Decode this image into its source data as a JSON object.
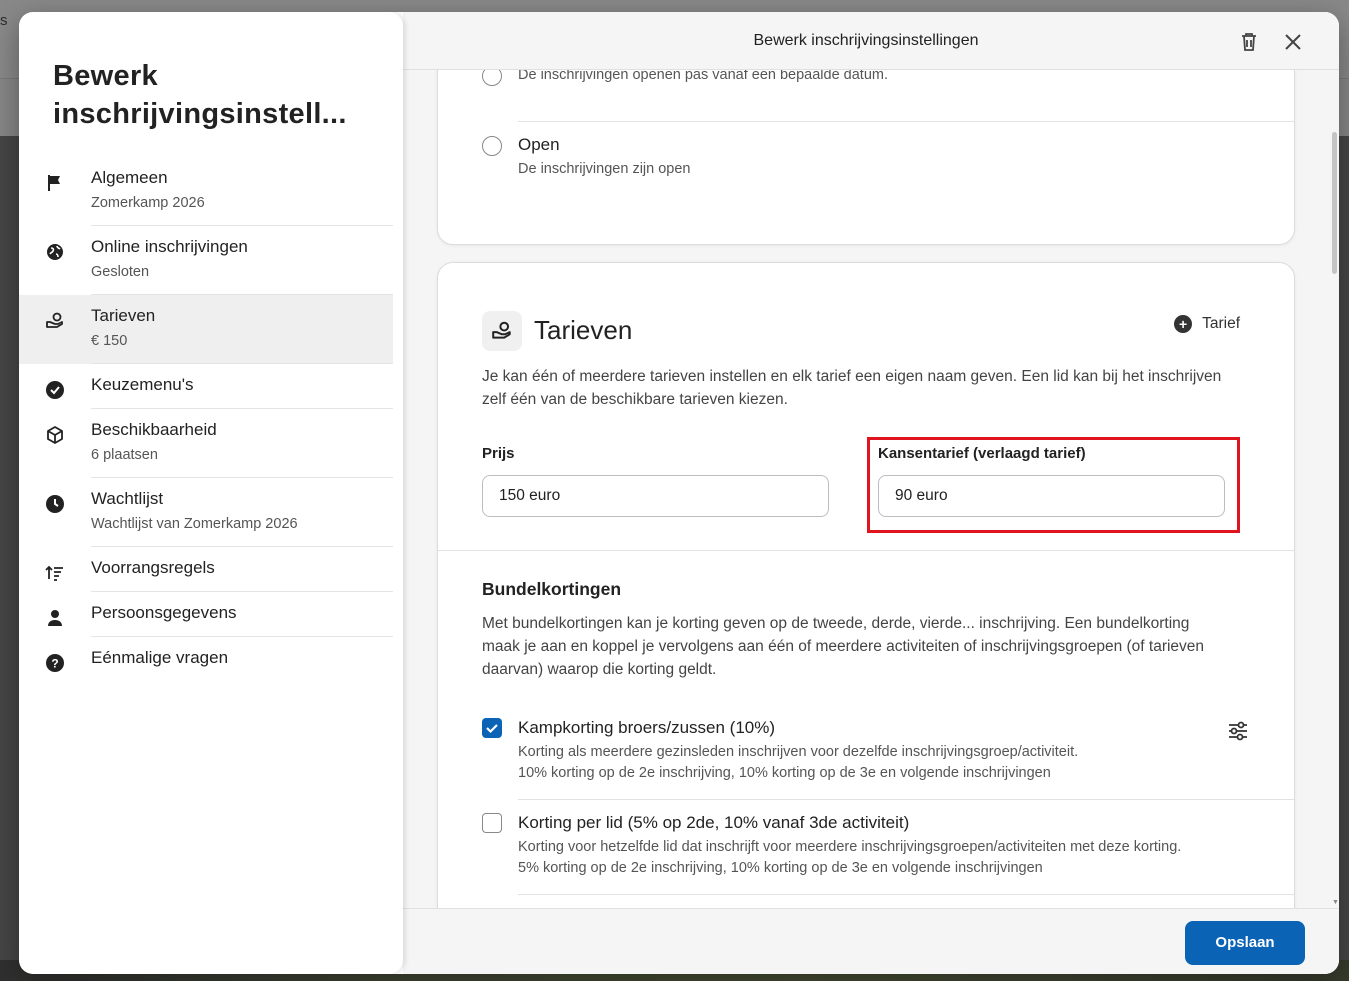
{
  "background": {
    "letter": "s"
  },
  "sidebar": {
    "title": "Bewerk inschrijvingsinstell...",
    "items": [
      {
        "label": "Algemeen",
        "sub": "Zomerkamp 2026",
        "icon": "flag-icon"
      },
      {
        "label": "Online inschrijvingen",
        "sub": "Gesloten",
        "icon": "globe-icon"
      },
      {
        "label": "Tarieven",
        "sub": "€ 150",
        "icon": "hand-coin-icon"
      },
      {
        "label": "Keuzemenu's",
        "sub": "",
        "icon": "check-circle-icon"
      },
      {
        "label": "Beschikbaarheid",
        "sub": "6 plaatsen",
        "icon": "box-icon"
      },
      {
        "label": "Wachtlijst",
        "sub": "Wachtlijst van Zomerkamp 2026",
        "icon": "clock-icon"
      },
      {
        "label": "Voorrangsregels",
        "sub": "",
        "icon": "sort-priority-icon"
      },
      {
        "label": "Persoonsgegevens",
        "sub": "",
        "icon": "person-icon"
      },
      {
        "label": "Eénmalige vragen",
        "sub": "",
        "icon": "help-circle-icon"
      }
    ]
  },
  "header": {
    "title": "Bewerk inschrijvingsinstellingen"
  },
  "status_card": {
    "options": [
      {
        "label": "",
        "sub": "De inschrijvingen openen pas vanaf een bepaalde datum."
      },
      {
        "label": "Open",
        "sub": "De inschrijvingen zijn open"
      }
    ]
  },
  "tarieven": {
    "title": "Tarieven",
    "add_label": "Tarief",
    "description": "Je kan één of meerdere tarieven instellen en elk tarief een eigen naam geven. Een lid kan bij het inschrijven zelf één van de beschikbare tarieven kiezen.",
    "price_label": "Prijs",
    "price_value": "150 euro",
    "reduced_label": "Kansentarief (verlaagd tarief)",
    "reduced_value": "90 euro"
  },
  "bundel": {
    "title": "Bundelkortingen",
    "description": "Met bundelkortingen kan je korting geven op de tweede, derde, vierde... inschrijving. Een bundelkorting maak je aan en koppel je vervolgens aan één of meerdere activiteiten of inschrijvingsgroepen (of tarieven daarvan) waarop die korting geldt.",
    "options": [
      {
        "label": "Kampkorting broers/zussen (10%)",
        "checked": true,
        "sub1": "Korting als meerdere gezinsleden inschrijven voor dezelfde inschrijvingsgroep/activiteit.",
        "sub2": "10% korting op de 2e inschrijving, 10% korting op de 3e en volgende inschrijvingen"
      },
      {
        "label": "Korting per lid (5% op 2de, 10% vanaf 3de activiteit)",
        "checked": false,
        "sub1": "Korting voor hetzelfde lid dat inschrijft voor meerdere inschrijvingsgroepen/activiteiten met deze korting.",
        "sub2": "5% korting op de 2e inschrijving, 10% korting op de 3e en volgende inschrijvingen"
      }
    ]
  },
  "footer": {
    "save_label": "Opslaan"
  },
  "colors": {
    "accent": "#0b63b5",
    "highlight": "#e0141e"
  }
}
